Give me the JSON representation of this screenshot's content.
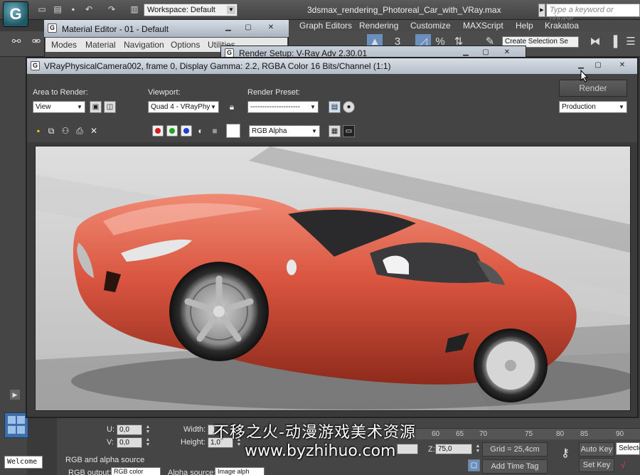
{
  "app": {
    "logo_glyph": "G",
    "workspace_label": "Workspace: Default",
    "file_title": "3dsmax_rendering_Photoreal_Car_with_VRay.max",
    "search_placeholder": "Type a keyword or phrase",
    "main_menu": [
      "Graph Editors",
      "Rendering",
      "Customize",
      "MAXScript",
      "Help",
      "Krakatoa"
    ],
    "selection_set": "Create Selection Se",
    "toolbar_glyphs": {
      "number3": "3",
      "percent": "%"
    },
    "welcome": "Welcome"
  },
  "material_editor": {
    "title": "Material Editor - 01 - Default",
    "menu": [
      "Modes",
      "Material",
      "Navigation",
      "Options",
      "Utilities"
    ]
  },
  "render_setup": {
    "title": "Render Setup: V-Ray Adv 2.30.01"
  },
  "vfb": {
    "title": "VRayPhysicalCamera002, frame 0, Display Gamma: 2.2, RGBA Color 16 Bits/Channel (1:1)",
    "area_label": "Area to Render:",
    "area_value": "View",
    "viewport_label": "Viewport:",
    "viewport_value": "Quad 4 - VRayPhy",
    "preset_label": "Render Preset:",
    "preset_value": "---------------------",
    "render_button": "Render",
    "production_value": "Production",
    "channel_value": "RGB Alpha"
  },
  "bottom": {
    "u_label": "U:",
    "u_value": "0,0",
    "v_label": "V:",
    "v_value": "0,0",
    "width_label": "Width:",
    "height_label": "Height:",
    "height_value": "1,0",
    "rgb_section": "RGB and alpha source",
    "rgb_output_label": "RGB output:",
    "rgb_output_value": "RGB color",
    "alpha_source_label": "Alpha source:",
    "alpha_source_value": "Image alph",
    "ruler": [
      "60",
      "65",
      "70",
      "75",
      "80",
      "85",
      "90"
    ],
    "z_label": "Z:",
    "z_value": "75,0",
    "grid": "Grid = 25,4cm",
    "add_time_tag": "Add Time Tag",
    "auto_key": "Auto Key",
    "selected": "Selecte",
    "set_key": "Set Key"
  },
  "watermark": {
    "line1": "不移之火-动漫游戏美术资源",
    "line2": "www.byzhihuo.com"
  },
  "colors": {
    "car_body": "#d9553f",
    "titlebar": "#c5cdd8",
    "panel": "#444444"
  }
}
